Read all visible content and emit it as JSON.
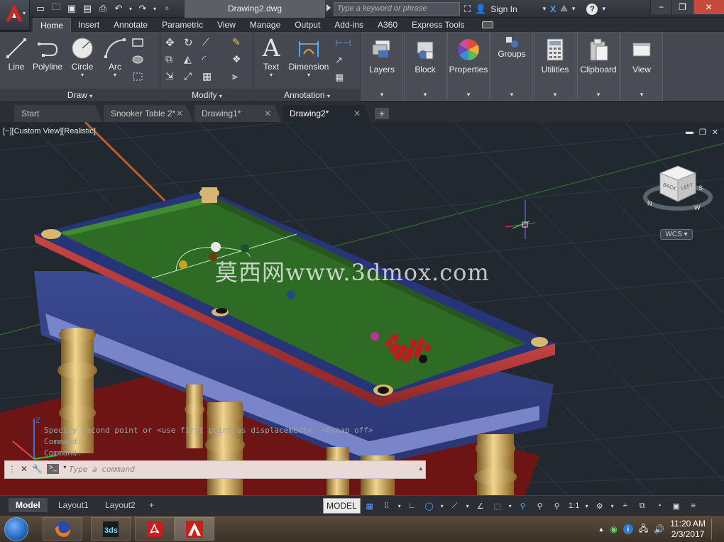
{
  "titlebar": {
    "document_title": "Drawing2.dwg",
    "search_placeholder": "Type a keyword or phrase",
    "signin_label": "Sign In"
  },
  "ribbon": {
    "tabs": [
      "Home",
      "Insert",
      "Annotate",
      "Parametric",
      "View",
      "Manage",
      "Output",
      "Add-ins",
      "A360",
      "Express Tools"
    ],
    "active_tab": "Home",
    "draw_tools": [
      "Line",
      "Polyline",
      "Circle",
      "Arc"
    ],
    "annotation_tools": [
      "Text",
      "Dimension"
    ],
    "panels": [
      "Draw",
      "Modify",
      "Annotation"
    ],
    "right_panels": [
      "Layers",
      "Block",
      "Properties",
      "Groups",
      "Utilities",
      "Clipboard",
      "View"
    ]
  },
  "file_tabs": [
    {
      "label": "Start"
    },
    {
      "label": "Snooker Table 2*"
    },
    {
      "label": "Drawing1*"
    },
    {
      "label": "Drawing2*"
    }
  ],
  "viewport": {
    "label": "[−][Custom View][Realistic]",
    "watermark": "莫西网www.3dmox.com",
    "viewcube": {
      "left": "LEFT",
      "back": "BACK"
    },
    "compass": {
      "n": "N",
      "w": "W",
      "s": "S"
    },
    "wcs_label": "WCS"
  },
  "command": {
    "history": [
      "Specify second point or <use first point as displacement>:  <Osnap off>",
      "Command:",
      "Command:"
    ],
    "placeholder": "Type a command"
  },
  "layout_tabs": [
    "Model",
    "Layout1",
    "Layout2"
  ],
  "status": {
    "model_label": "MODEL",
    "scale_label": "1:1"
  },
  "taskbar": {
    "time": "11:20 AM",
    "date": "2/3/2017"
  },
  "colors": {
    "felt": "#2e6b25",
    "cushion_red": "#b8383a",
    "body_navy": "#2c3a7a",
    "leg_gold": "#c9a35a",
    "floor_red": "#6d1515"
  }
}
